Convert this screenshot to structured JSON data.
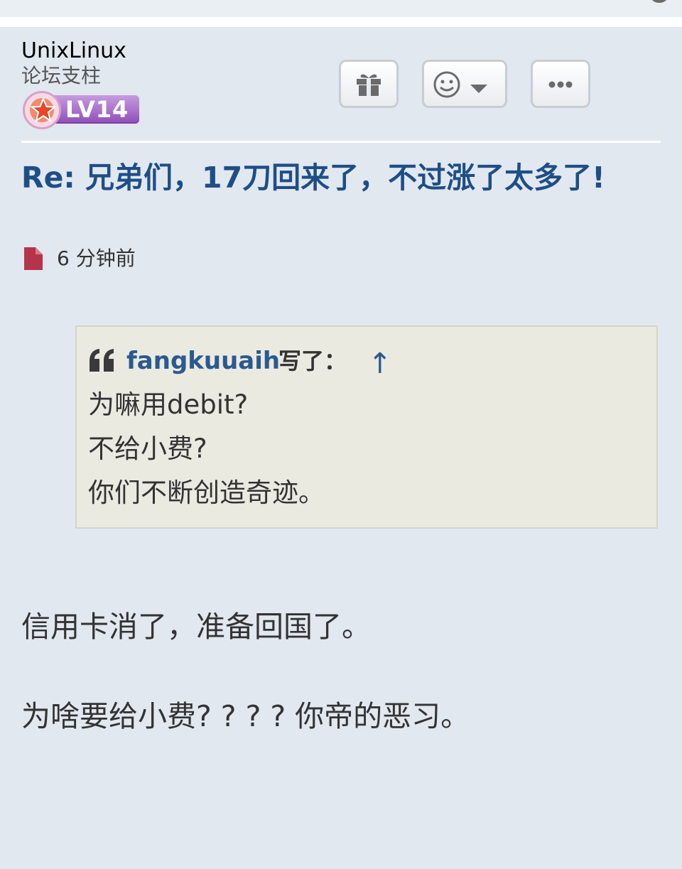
{
  "post": {
    "author": {
      "username": "UnixLinux",
      "rank": "论坛支柱",
      "level": "LV14"
    },
    "actions": {
      "gift_icon": "gift-icon",
      "react_icon": "smiley-icon",
      "more_icon": "ellipsis-icon"
    },
    "title": "Re: 兄弟们，17刀回来了，不过涨了太多了!",
    "time": "6 分钟前",
    "quote": {
      "author": "fangkuuaih",
      "wrote": "写了：",
      "up_arrow": "↑",
      "lines": [
        "为嘛用debit?",
        "不给小费?",
        "你们不断创造奇迹。"
      ]
    },
    "reply_lines": [
      "信用卡消了，准备回国了。",
      "为啥要给小费? ? ? ? 你帝的恶习。"
    ]
  },
  "colors": {
    "background": "#e1e8f0",
    "title": "#1f4e86",
    "quote_bg": "#ebeae1",
    "link": "#2a5a8e",
    "file_icon": "#b5344c",
    "level_badge": "#a66bcf"
  }
}
